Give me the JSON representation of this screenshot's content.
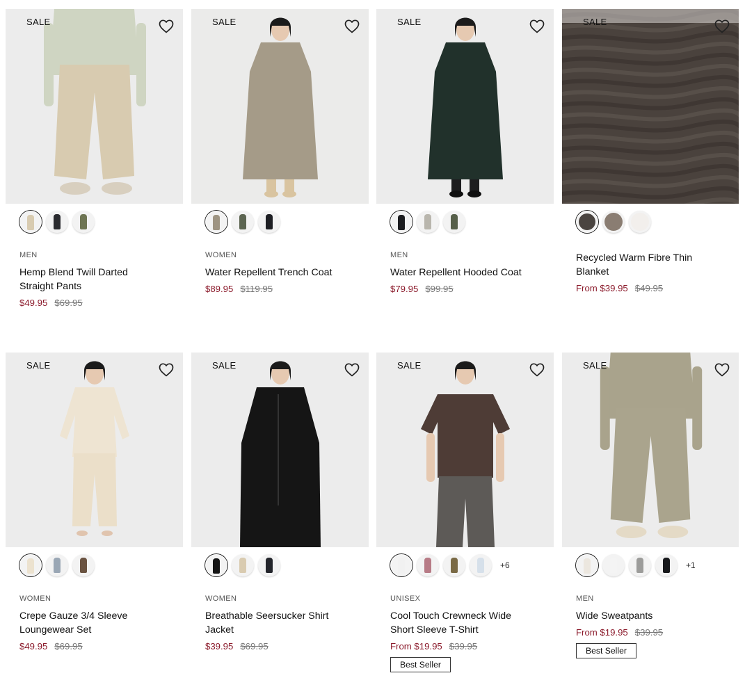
{
  "products": [
    {
      "sale_label": "SALE",
      "category": "MEN",
      "name": "Hemp Blend Twill Darted Straight Pants",
      "price": "$49.95",
      "original_price": "$69.95",
      "badge": "",
      "swatches": [
        "#d8cbb0",
        "#2a2b2f",
        "#6e7553"
      ],
      "more_colors": "",
      "art": {
        "bg": "#ececec",
        "top": "#cfd5c2",
        "bottom": "#d8cbb0",
        "shoe": "#d8cfbf",
        "kind": "pants"
      }
    },
    {
      "sale_label": "SALE",
      "category": "WOMEN",
      "name": "Water Repellent Trench Coat",
      "price": "$89.95",
      "original_price": "$119.95",
      "badge": "",
      "swatches": [
        "#9e9482",
        "#5c6551",
        "#1e1f24"
      ],
      "more_colors": "",
      "art": {
        "bg": "#ebebea",
        "top": "#a59b88",
        "bottom": "#d9c4a0",
        "shoe": "#d9c4a0",
        "kind": "coat"
      }
    },
    {
      "sale_label": "SALE",
      "category": "MEN",
      "name": "Water Repellent Hooded Coat",
      "price": "$79.95",
      "original_price": "$99.95",
      "badge": "",
      "swatches": [
        "#1b1c1f",
        "#b9b6ad",
        "#57604a"
      ],
      "more_colors": "",
      "art": {
        "bg": "#ececec",
        "top": "#21312b",
        "bottom": "#1d1d1f",
        "shoe": "#111111",
        "kind": "coat"
      }
    },
    {
      "sale_label": "SALE",
      "category": "",
      "name": "Recycled Warm Fibre Thin Blanket",
      "price": "From $39.95",
      "original_price": "$49.95",
      "badge": "",
      "swatches": [
        "#4a4440",
        "#8a7d72",
        "#f2efec"
      ],
      "more_colors": "",
      "art": {
        "bg": "#4a423d",
        "top": "#5a524c",
        "bottom": "#3c3531",
        "shoe": "#4a423d",
        "kind": "blanket"
      }
    },
    {
      "sale_label": "SALE",
      "category": "WOMEN",
      "name": "Crepe Gauze 3/4 Sleeve Loungewear Set",
      "price": "$49.95",
      "original_price": "$69.95",
      "badge": "",
      "swatches": [
        "#ece2cf",
        "#9aa7b5",
        "#6a5341"
      ],
      "more_colors": "",
      "art": {
        "bg": "#ececec",
        "top": "#eee4d2",
        "bottom": "#ebdfc9",
        "shoe": "#e0c4ae",
        "kind": "set"
      }
    },
    {
      "sale_label": "SALE",
      "category": "WOMEN",
      "name": "Breathable Seersucker Shirt Jacket",
      "price": "$39.95",
      "original_price": "$69.95",
      "badge": "",
      "swatches": [
        "#141414",
        "#d9cbb0",
        "#23252b"
      ],
      "more_colors": "",
      "art": {
        "bg": "#ececec",
        "top": "#151515",
        "bottom": "#1a1a1a",
        "shoe": "#151515",
        "kind": "jacket"
      }
    },
    {
      "sale_label": "SALE",
      "category": "UNISEX",
      "name": "Cool Touch Crewneck Wide Short Sleeve T-Shirt",
      "price": "From $19.95",
      "original_price": "$39.95",
      "badge": "Best Seller",
      "swatches": [
        "#f1f1f1",
        "#b77b86",
        "#7a6a45",
        "#d6e0ea"
      ],
      "more_colors": "+6",
      "art": {
        "bg": "#ececec",
        "top": "#4e3c36",
        "bottom": "#5d5a57",
        "shoe": "#555",
        "kind": "tee"
      }
    },
    {
      "sale_label": "SALE",
      "category": "MEN",
      "name": "Wide Sweatpants",
      "price": "From $19.95",
      "original_price": "$39.95",
      "badge": "Best Seller",
      "swatches": [
        "#ece7df",
        "#f4f4f4",
        "#9c9c9a",
        "#17181b"
      ],
      "more_colors": "+1",
      "art": {
        "bg": "#ececec",
        "top": "#a9a38c",
        "bottom": "#aaa48d",
        "shoe": "#e4dac6",
        "kind": "sweat"
      }
    }
  ]
}
